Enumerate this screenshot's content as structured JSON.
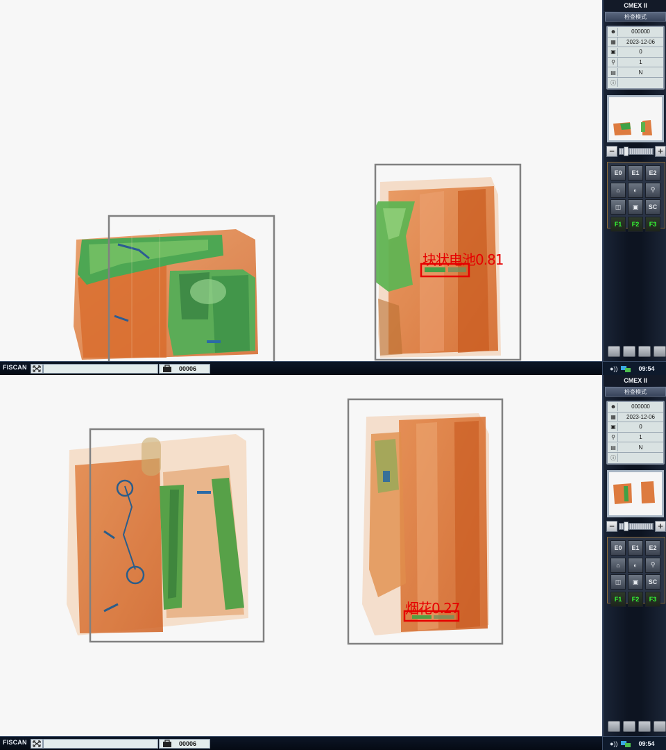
{
  "app": {
    "title": "CMEX II",
    "mode": "检查模式",
    "brand": "FISCAN",
    "bag_count": "00006",
    "clock": "09:54"
  },
  "info": [
    {
      "icon": "operator-icon",
      "value": "000000"
    },
    {
      "icon": "calendar-icon",
      "value": "2023-12-06"
    },
    {
      "icon": "counter-icon",
      "value": "0"
    },
    {
      "icon": "search-icon",
      "value": "1"
    },
    {
      "icon": "tray-icon",
      "value": "N"
    },
    {
      "icon": "info-icon",
      "value": ""
    }
  ],
  "grid_buttons": [
    {
      "name": "e0-button",
      "label": "E0"
    },
    {
      "name": "e1-button",
      "label": "E1"
    },
    {
      "name": "e2-button",
      "label": "E2"
    },
    {
      "name": "home-button",
      "label": ""
    },
    {
      "name": "contrast-button",
      "label": ""
    },
    {
      "name": "zoom-button",
      "label": ""
    },
    {
      "name": "mirror-button",
      "label": ""
    },
    {
      "name": "camera-button",
      "label": ""
    },
    {
      "name": "sc-button",
      "label": "SC"
    },
    {
      "name": "f1-button",
      "label": "F1"
    },
    {
      "name": "f2-button",
      "label": "F2"
    },
    {
      "name": "f3-button",
      "label": "F3"
    }
  ],
  "detections": {
    "top": {
      "label": "块状电池0.81"
    },
    "bottom": {
      "label": "烟花0.27"
    }
  },
  "colors": {
    "organic": "#d9621a",
    "inorganic": "#3e9a3a",
    "metal": "#1a5fa0",
    "alarm": "#e60000",
    "fkey": "#35ff35"
  }
}
